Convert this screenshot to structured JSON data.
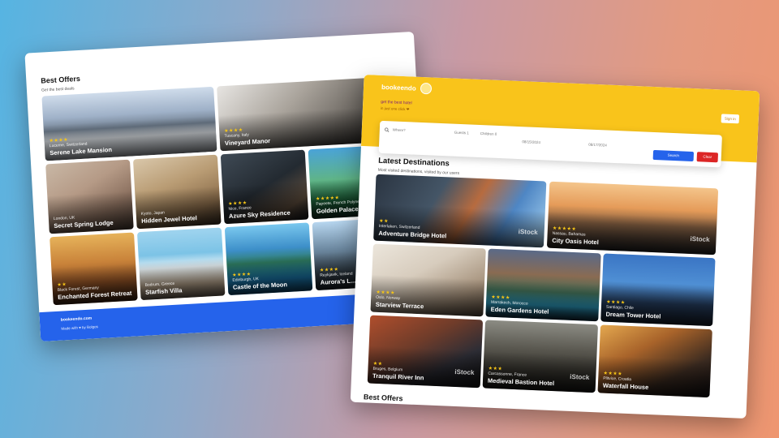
{
  "back_window": {
    "title": "Best Offers",
    "subtitle": "Get the best deals",
    "cards": [
      {
        "stars": "★★★★",
        "location": "Lucerne, Switzerland",
        "name": "Serene Lake Mansion",
        "watermark": ""
      },
      {
        "stars": "★★★★",
        "location": "Tuscany, Italy",
        "name": "Vineyard Manor",
        "watermark": "iStock"
      },
      {
        "stars": "",
        "location": "London, UK",
        "name": "Secret Spring Lodge",
        "watermark": ""
      },
      {
        "stars": "",
        "location": "Kyoto, Japan",
        "name": "Hidden Jewel Hotel",
        "watermark": ""
      },
      {
        "stars": "★★★★",
        "location": "Nice, France",
        "name": "Azure Sky Residence",
        "watermark": ""
      },
      {
        "stars": "★★★★★",
        "location": "Papeete, French Polynesia",
        "name": "Golden Palace",
        "watermark": ""
      },
      {
        "stars": "★★",
        "location": "Black Forest, Germany",
        "name": "Enchanted Forest Retreat",
        "watermark": ""
      },
      {
        "stars": "",
        "location": "Bodrum, Greece",
        "name": "Starfish Villa",
        "watermark": ""
      },
      {
        "stars": "★★★★",
        "location": "Edinburgh, UK",
        "name": "Castle of the Moon",
        "watermark": ""
      },
      {
        "stars": "★★★★",
        "location": "Reykjavik, Iceland",
        "name": "Aurora's L...",
        "watermark": ""
      }
    ],
    "footer": {
      "brand": "bookeendo.com",
      "credit": "Made with ♥ by Bolgos"
    }
  },
  "front_window": {
    "logo": "bookeendo",
    "tagline": "get the best hotel",
    "tagline2": "in just one click ❤",
    "signin": "Sign in",
    "search": {
      "destination_placeholder": "Where?",
      "guests": "Guests 1",
      "rooms": "Children 0",
      "checkin": "08/15/2024",
      "checkout": "08/17/2024",
      "search_label": "Search",
      "clear_label": "Clear"
    },
    "section_title": "Latest Destinations",
    "section_subtitle": "Most visited destinations, visited by our users",
    "cards": [
      {
        "stars": "★★",
        "location": "Interlaken, Switzerland",
        "name": "Adventure Bridge Hotel",
        "watermark": "iStock"
      },
      {
        "stars": "★★★★★",
        "location": "Nassau, Bahamas",
        "name": "City Oasis Hotel",
        "watermark": "iStock"
      },
      {
        "stars": "★★★★",
        "location": "Oslo, Norway",
        "name": "Starview Terrace",
        "watermark": ""
      },
      {
        "stars": "★★★★",
        "location": "Marrakech, Morocco",
        "name": "Eden Gardens Hotel",
        "watermark": ""
      },
      {
        "stars": "★★★★",
        "location": "Santiago, Chile",
        "name": "Dream Tower Hotel",
        "watermark": ""
      },
      {
        "stars": "★★",
        "location": "Bruges, Belgium",
        "name": "Tranquil River Inn",
        "watermark": "iStock"
      },
      {
        "stars": "★★★",
        "location": "Carcassonne, France",
        "name": "Medieval Bastion Hotel",
        "watermark": "iStock"
      },
      {
        "stars": "★★★★",
        "location": "Plitvice, Croatia",
        "name": "Waterfall House",
        "watermark": ""
      }
    ],
    "tail": "Best Offers"
  }
}
